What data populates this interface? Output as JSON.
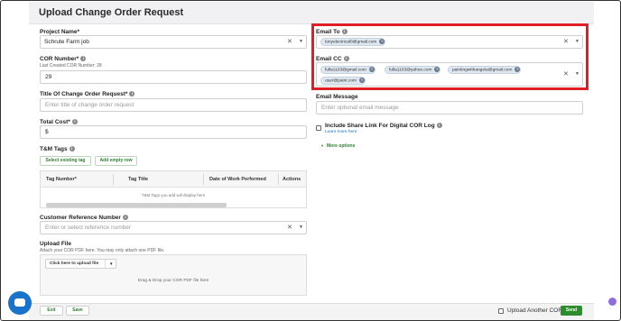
{
  "header": {
    "title": "Upload Change Order Request"
  },
  "project": {
    "label": "Project Name*",
    "value": "Schrute Farm job"
  },
  "cor_number": {
    "label": "COR Number*",
    "last_created": "Last Created COR Number: 28",
    "value": "29"
  },
  "title_field": {
    "label": "Title Of Change Order Request*",
    "placeholder": "Enter title of change order request"
  },
  "total_cost": {
    "label": "Total Cost*",
    "value": "$"
  },
  "tm_tags": {
    "label": "T&M Tags",
    "select_existing": "Select existing tag",
    "add_empty": "Add empty row",
    "columns": [
      "Tag Number*",
      "Tag Title",
      "Date of Work Performed",
      "Actions"
    ],
    "empty_text": "T&M Tags you add will display here"
  },
  "customer_ref": {
    "label": "Customer Reference Number",
    "placeholder": "Enter or select reference number"
  },
  "upload_file": {
    "label": "Upload File",
    "hint": "Attach your COR PDF here. You may only attach one PDF file.",
    "button": "Click here to upload file",
    "drop_text": "Drag & Drop your COR PDF file here"
  },
  "email_to": {
    "label": "Email To",
    "chips": [
      "tonyelectrical0@gmail.com"
    ]
  },
  "email_cc": {
    "label": "Email CC",
    "chips": [
      "fulla1103@gmail.com",
      "fulla1103@yahoo.com",
      "paintingwithangela@gmail.com",
      "user@paint.com"
    ]
  },
  "email_message": {
    "label": "Email Message",
    "placeholder": "Enter optional email message"
  },
  "share_link": {
    "label": "Include Share Link For Digital COR Log",
    "learn_more": "Learn more here"
  },
  "more_options": "More options",
  "footer": {
    "exit": "Exit",
    "save": "Save",
    "upload_another": "Upload Another COR",
    "send": "Send"
  },
  "colors": {
    "accent_green": "#2e8b2e",
    "highlight_red": "#e01e26",
    "chat_blue": "#1a73c8"
  }
}
